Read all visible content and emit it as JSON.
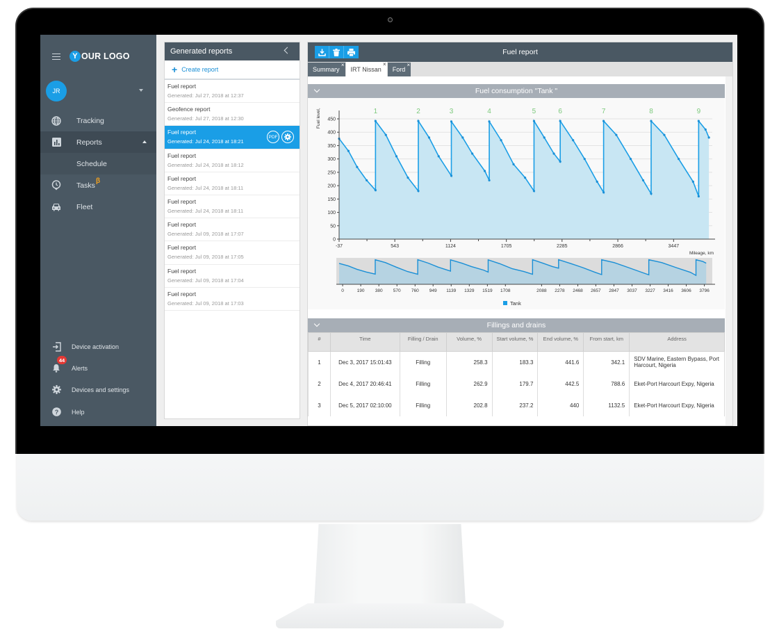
{
  "sidebar": {
    "logo_text": "OUR LOGO",
    "logo_letter": "Y",
    "user_initials": "JR",
    "nav": [
      {
        "label": "Tracking",
        "icon": "globe-icon"
      },
      {
        "label": "Reports",
        "icon": "bar-chart-icon"
      },
      {
        "label": "Schedule"
      },
      {
        "label": "Tasks",
        "icon": "clock-icon",
        "badge": "β"
      },
      {
        "label": "Fleet",
        "icon": "car-icon"
      }
    ],
    "bottom": [
      {
        "label": "Device activation",
        "icon": "login-icon"
      },
      {
        "label": "Alerts",
        "icon": "bell-icon",
        "badge": "44"
      },
      {
        "label": "Devices and settings",
        "icon": "gear-icon"
      },
      {
        "label": "Help",
        "icon": "help-icon"
      }
    ]
  },
  "reports_panel": {
    "title": "Generated reports",
    "create_label": "Create report",
    "pdf_label": "PDF",
    "items": [
      {
        "title": "Fuel report",
        "generated": "Generated: Jul 27, 2018 at 12:37"
      },
      {
        "title": "Geofence report",
        "generated": "Generated: Jul 27, 2018 at 12:30"
      },
      {
        "title": "Fuel report",
        "generated": "Generated: Jul 24, 2018 at 18:21",
        "selected": true
      },
      {
        "title": "Fuel report",
        "generated": "Generated: Jul 24, 2018 at 18:12"
      },
      {
        "title": "Fuel report",
        "generated": "Generated: Jul 24, 2018 at 18:11"
      },
      {
        "title": "Fuel report",
        "generated": "Generated: Jul 24, 2018 at 18:11"
      },
      {
        "title": "Fuel report",
        "generated": "Generated: Jul 09, 2018 at 17:07"
      },
      {
        "title": "Fuel report",
        "generated": "Generated: Jul 09, 2018 at 17:05"
      },
      {
        "title": "Fuel report",
        "generated": "Generated: Jul 09, 2018 at 17:04"
      },
      {
        "title": "Fuel report",
        "generated": "Generated: Jul 09, 2018 at 17:03"
      }
    ]
  },
  "report": {
    "title": "Fuel report",
    "tabs": [
      {
        "label": "Summary",
        "active": false
      },
      {
        "label": "IRT Nissan",
        "active": true
      },
      {
        "label": "Ford",
        "active": false
      }
    ],
    "tab_close": "×",
    "chart_section_title": "Fuel consumption \"Tank \"",
    "table_section_title": "Fillings and drains",
    "table": {
      "columns": [
        "#",
        "Time",
        "Filling / Drain",
        "Volume, %",
        "Start volume, %",
        "End volume, %",
        "From start, km",
        "Address"
      ],
      "rows": [
        [
          "1",
          "Dec 3, 2017 15:01:43",
          "Filling",
          "258.3",
          "183.3",
          "441.6",
          "342.1",
          "SDV Marine, Eastern Bypass, Port Harcourt, Nigeria"
        ],
        [
          "2",
          "Dec 4, 2017 20:46:41",
          "Filling",
          "262.9",
          "179.7",
          "442.5",
          "788.6",
          "Eket-Port Harcourt Expy, Nigeria"
        ],
        [
          "3",
          "Dec 5, 2017 02:10:00",
          "Filling",
          "202.8",
          "237.2",
          "440",
          "1132.5",
          "Eket-Port Harcourt Expy, Nigeria"
        ]
      ]
    }
  },
  "colors": {
    "accent": "#1a9ee6",
    "sidebar_bg": "#4a5863",
    "section_head": "#a7aeb6",
    "fill_marker": "#7cc97c",
    "series_fill": "#c8e6f3"
  },
  "chart_data": {
    "type": "area",
    "title": "Fuel consumption \"Tank \"",
    "ylabel": "Fuel level,",
    "xlabel": "Mileage, km",
    "ylim": [
      0,
      450
    ],
    "xlim": [
      -37,
      3850
    ],
    "yticks": [
      0,
      50,
      100,
      150,
      200,
      250,
      300,
      350,
      400,
      450
    ],
    "xticks": [
      -37,
      543,
      1124,
      1705,
      2285,
      2866,
      3447
    ],
    "grid": true,
    "legend": {
      "position": "bottom",
      "entries": [
        "Tank"
      ]
    },
    "series": [
      {
        "name": "Tank",
        "x": [
          -37,
          60,
          150,
          250,
          342,
          342,
          450,
          560,
          680,
          788,
          788,
          900,
          1000,
          1132,
          1132,
          1250,
          1350,
          1480,
          1527,
          1527,
          1650,
          1780,
          1900,
          1993,
          1993,
          2100,
          2200,
          2266,
          2266,
          2400,
          2520,
          2650,
          2718,
          2718,
          2850,
          3000,
          3130,
          3213,
          3213,
          3350,
          3500,
          3650,
          3708,
          3708,
          3780,
          3815
        ],
        "values": [
          376,
          330,
          270,
          220,
          183,
          442,
          390,
          310,
          230,
          180,
          442,
          380,
          310,
          237,
          440,
          380,
          320,
          255,
          220,
          440,
          370,
          280,
          230,
          180,
          442,
          380,
          320,
          290,
          442,
          370,
          300,
          215,
          175,
          442,
          390,
          300,
          220,
          170,
          442,
          390,
          300,
          215,
          160,
          442,
          410,
          380
        ]
      }
    ],
    "annotations": [
      "1",
      "2",
      "3",
      "4",
      "5",
      "6",
      "7",
      "8",
      "9"
    ],
    "annotation_x": [
      342,
      788,
      1132,
      1527,
      1993,
      2266,
      2718,
      3213,
      3708
    ],
    "navigator": {
      "xticks": [
        0,
        190,
        380,
        570,
        760,
        949,
        1139,
        1329,
        1519,
        1708,
        2088,
        2278,
        2468,
        2657,
        2847,
        3037,
        3227,
        3416,
        3606,
        3796
      ]
    }
  }
}
